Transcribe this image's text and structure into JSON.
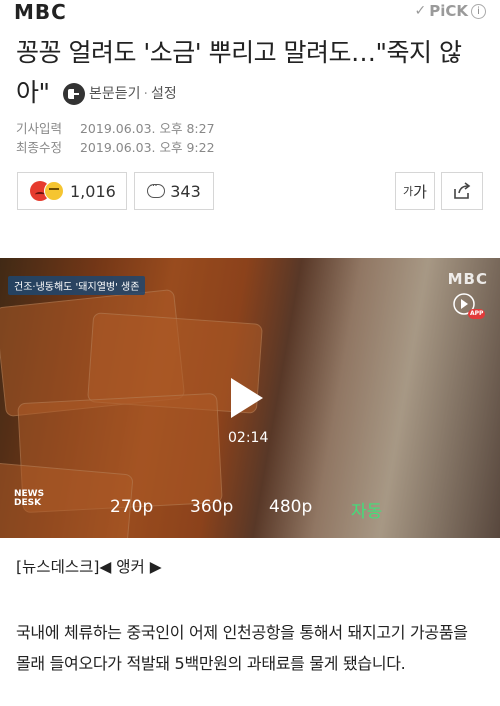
{
  "header": {
    "logo": "MBC",
    "pick_label": "PiCK",
    "pick_check": "✓",
    "info_glyph": "i"
  },
  "article": {
    "title": "꽁꽁 얼려도 '소금' 뿌리고 말려도…\"죽지 않아\"",
    "tts_label": "본문듣기",
    "separator": "·",
    "settings_label": "설정",
    "published_label": "기사입력",
    "published_value": "2019.06.03. 오후 8:27",
    "modified_label": "최종수정",
    "modified_value": "2019.06.03. 오후 9:22"
  },
  "actions": {
    "reaction_count": "1,016",
    "comment_count": "343",
    "font_size_label_small": "가",
    "font_size_label_large": "가"
  },
  "video": {
    "caption_tag": "건조·냉동해도 '돼지열병' 생존",
    "watermark": "MBC",
    "app_label": "APP",
    "duration": "02:14",
    "newsdesk_line1": "NEWS",
    "newsdesk_line2": "DESK",
    "qualities": [
      "270p",
      "360p",
      "480p",
      "자동"
    ]
  },
  "body": {
    "anchor_line": "[뉴스데스크]◀ 앵커 ▶",
    "paragraph": "국내에 체류하는 중국인이 어제 인천공항을 통해서 돼지고기 가공품을 몰래 들여오다가 적발돼 5백만원의 과태료를 물게 됐습니다."
  },
  "colors": {
    "auto_quality": "#40e07a",
    "reaction_angry": "#e63b2e",
    "reaction_laugh": "#f5c531"
  }
}
